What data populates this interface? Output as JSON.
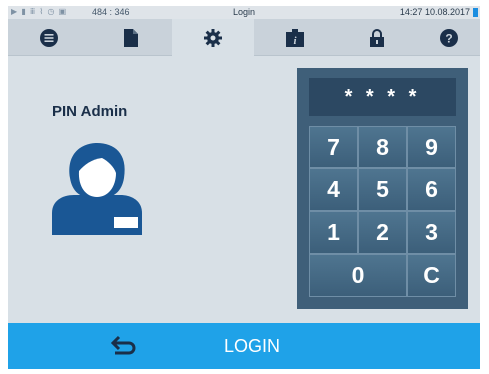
{
  "status_bar": {
    "coords": "484 : 346",
    "title": "Login",
    "time": "14:27",
    "date": "10.08.2017",
    "icons": [
      "play-icon",
      "document-icon",
      "sterilizer-icon",
      "chart-icon",
      "clock-icon",
      "lock-icon"
    ],
    "battery_color": "#1b8de0"
  },
  "tabs": [
    {
      "icon": "menu-icon",
      "active": false
    },
    {
      "icon": "document-icon",
      "active": false
    },
    {
      "icon": "gear-icon",
      "active": true
    },
    {
      "icon": "info-device-icon",
      "active": false
    },
    {
      "icon": "lock-icon",
      "active": false
    },
    {
      "icon": "help-icon",
      "active": false
    }
  ],
  "login": {
    "pin_label": "PIN Admin",
    "pin_display": "* * * *",
    "keys": [
      "7",
      "8",
      "9",
      "4",
      "5",
      "6",
      "1",
      "2",
      "3",
      "0",
      "C"
    ]
  },
  "bottom_bar": {
    "back_icon": "back-arrow-icon",
    "title": "LOGIN"
  },
  "colors": {
    "accent": "#1fa2e8",
    "icon_dark": "#1a2f49",
    "keypad_bg": "#3f5f79"
  }
}
